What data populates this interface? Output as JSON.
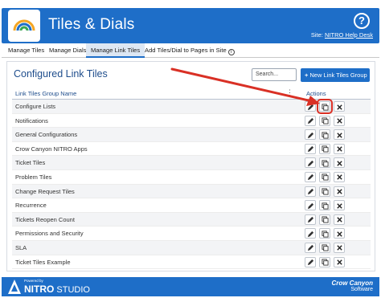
{
  "header": {
    "title": "Tiles & Dials",
    "help_icon": "help-icon",
    "site_prefix": "Site:",
    "site_link": "NITRO Help Desk",
    "color": "#1e6ec8"
  },
  "tabs": [
    {
      "label": "Manage Tiles",
      "active": false
    },
    {
      "label": "Manage Dials",
      "active": false
    },
    {
      "label": "Manage Link Tiles",
      "active": true
    },
    {
      "label": "Add Tiles/Dial to Pages in Site",
      "active": false
    }
  ],
  "panel": {
    "title": "Configured Link Tiles",
    "search_placeholder": "Search...",
    "new_button_label": "New Link Tiles Group",
    "new_button_icon": "+"
  },
  "table": {
    "columns": [
      "Link Tiles Group Name",
      "Actions"
    ],
    "column_menu_icon": "⋮",
    "rows": [
      "Configure Lists",
      "Notifications",
      "General Configurations",
      "Crow Canyon NITRO Apps",
      "Ticket Tiles",
      "Problem Tiles",
      "Change Request Tiles",
      "Recurrence",
      "Tickets Reopen Count",
      "Permissions and Security",
      "SLA",
      "Ticket Tiles Example"
    ],
    "row_actions": [
      "edit-icon",
      "copy-icon",
      "delete-icon"
    ],
    "highlighted_action": {
      "row": 0,
      "action": "copy"
    }
  },
  "annotation": {
    "arrow_color": "#d93025"
  },
  "footer": {
    "powered_by": "Powered by",
    "brand_bold": "NITRO",
    "brand_rest": " STUDIO",
    "company_line1": "Crow Canyon",
    "company_line2": "Software"
  }
}
